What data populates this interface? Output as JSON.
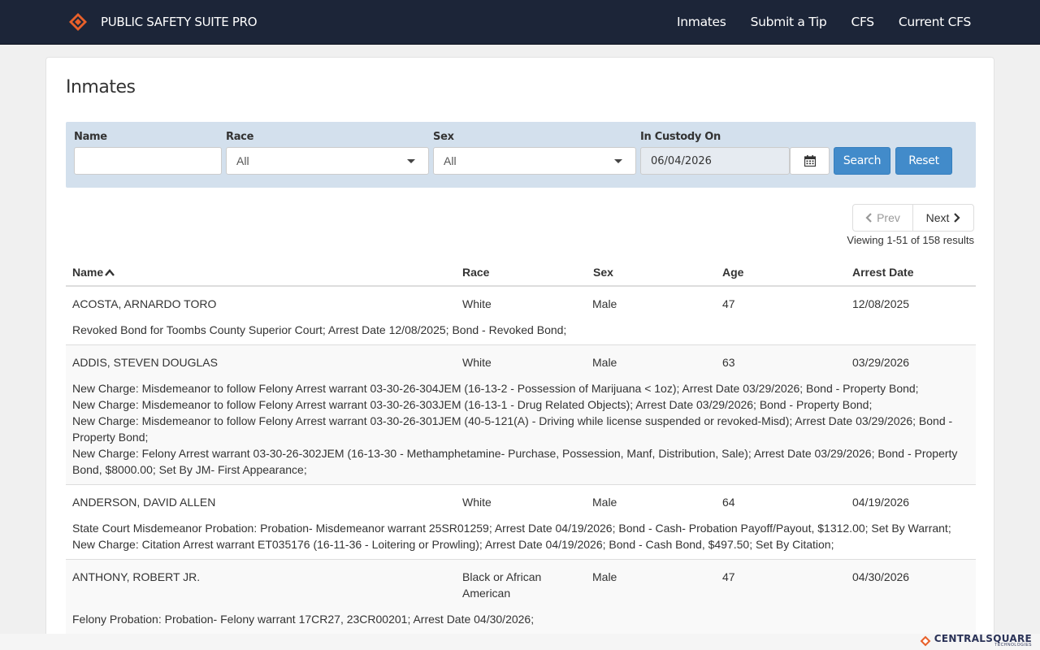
{
  "header": {
    "brand": "PUBLIC SAFETY SUITE PRO",
    "nav": [
      "Inmates",
      "Submit a Tip",
      "CFS",
      "Current CFS"
    ]
  },
  "page": {
    "title": "Inmates"
  },
  "filters": {
    "name_label": "Name",
    "name_value": "",
    "race_label": "Race",
    "race_value": "All",
    "sex_label": "Sex",
    "sex_value": "All",
    "custody_label": "In Custody On",
    "custody_value": "06/04/2026",
    "search_label": "Search",
    "reset_label": "Reset"
  },
  "pagination": {
    "prev_label": "Prev",
    "next_label": "Next",
    "viewing": "Viewing 1-51 of 158 results"
  },
  "table": {
    "columns": [
      "Name",
      "Race",
      "Sex",
      "Age",
      "Arrest Date"
    ],
    "rows": [
      {
        "name": "ACOSTA, ARNARDO TORO",
        "race": "White",
        "sex": "Male",
        "age": "47",
        "arrest_date": "12/08/2025",
        "charges": [
          "Revoked Bond for Toombs County Superior Court; Arrest Date 12/08/2025; Bond - Revoked Bond;"
        ]
      },
      {
        "name": "ADDIS, STEVEN DOUGLAS",
        "race": "White",
        "sex": "Male",
        "age": "63",
        "arrest_date": "03/29/2026",
        "charges": [
          "New Charge: Misdemeanor to follow Felony Arrest warrant 03-30-26-304JEM (16-13-2 - Possession of Marijuana < 1oz); Arrest Date 03/29/2026; Bond - Property Bond;",
          "New Charge: Misdemeanor to follow Felony Arrest warrant 03-30-26-303JEM (16-13-1 - Drug Related Objects); Arrest Date 03/29/2026; Bond - Property Bond;",
          "New Charge: Misdemeanor to follow Felony Arrest warrant 03-30-26-301JEM (40-5-121(A) - Driving while license suspended or revoked-Misd); Arrest Date 03/29/2026; Bond - Property Bond;",
          "New Charge: Felony Arrest warrant 03-30-26-302JEM (16-13-30 - Methamphetamine- Purchase, Possession, Manf, Distribution, Sale); Arrest Date 03/29/2026; Bond - Property Bond, $8000.00; Set By JM- First Appearance;"
        ]
      },
      {
        "name": "ANDERSON, DAVID ALLEN",
        "race": "White",
        "sex": "Male",
        "age": "64",
        "arrest_date": "04/19/2026",
        "charges": [
          "State Court Misdemeanor Probation: Probation- Misdemeanor warrant 25SR01259; Arrest Date 04/19/2026; Bond - Cash- Probation Payoff/Payout, $1312.00; Set By Warrant;",
          "New Charge: Citation Arrest warrant ET035176 (16-11-36 - Loitering or Prowling); Arrest Date 04/19/2026; Bond - Cash Bond, $497.50; Set By Citation;"
        ]
      },
      {
        "name": "ANTHONY, ROBERT JR.",
        "race": "Black or African American",
        "sex": "Male",
        "age": "47",
        "arrest_date": "04/30/2026",
        "charges": [
          "Felony Probation: Probation- Felony warrant 17CR27, 23CR00201; Arrest Date 04/30/2026;"
        ]
      }
    ]
  },
  "footer": {
    "logo_text": "CENTRALSQUARE",
    "logo_sub": "TECHNOLOGIES"
  }
}
